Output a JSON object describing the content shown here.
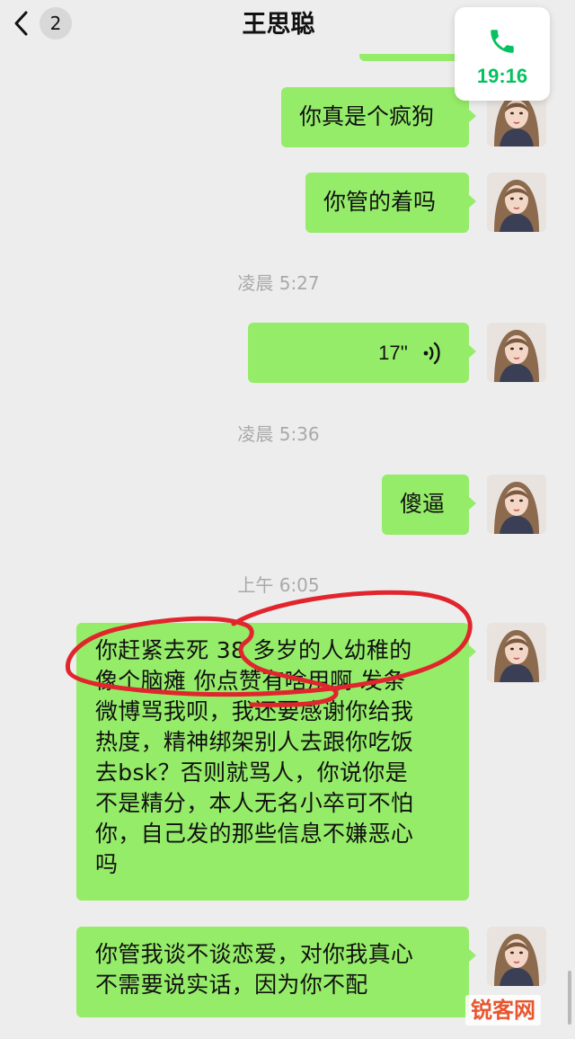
{
  "header": {
    "unread_count": "2",
    "contact_name": "王思聪"
  },
  "call_widget": {
    "duration": "19:16",
    "icon": "phone-icon",
    "accent_color": "#07c160"
  },
  "bubble_color": "#95ec69",
  "messages": [
    {
      "type": "text",
      "text": "你真是个疯狗"
    },
    {
      "type": "text",
      "text": "你管的着吗"
    },
    {
      "type": "timestamp",
      "text": "凌晨 5:27"
    },
    {
      "type": "voice",
      "duration": "17''",
      "icon": "voice-wave-icon"
    },
    {
      "type": "timestamp",
      "text": "凌晨 5:36"
    },
    {
      "type": "text",
      "text": "傻逼"
    },
    {
      "type": "timestamp",
      "text": "上午 6:05"
    },
    {
      "type": "text",
      "lines": [
        "你赶紧去死 38 多岁的人幼稚的",
        "像个脑瘫 你点赞有啥用啊 发条",
        "微博骂我呗，我还要感谢你给我",
        "热度，精神绑架别人去跟你吃饭",
        "去bsk？否则就骂人，你说你是",
        "不是精分，本人无名小卒可不怕",
        "你，自己发的那些信息不嫌恶心",
        "吗"
      ]
    },
    {
      "type": "text",
      "lines": [
        "你管我谈不谈恋爱，对你我真心",
        "不需要说实话，因为你不配"
      ]
    }
  ],
  "watermark": "锐客网",
  "annotation_color": "#e0262c"
}
